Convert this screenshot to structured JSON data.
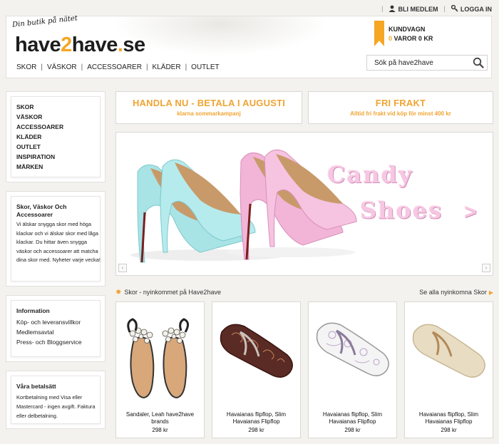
{
  "topbar": {
    "join": "BLI MEDLEM",
    "login": "LOGGA IN"
  },
  "header": {
    "tagline": "Din butik på nätet",
    "logo": {
      "part1": "have",
      "part2": "2",
      "part3": "have",
      "part4": ".",
      "part5": "se"
    },
    "nav": [
      "SKOR",
      "VÄSKOR",
      "ACCESSOARER",
      "KLÄDER",
      "OUTLET"
    ],
    "cart": {
      "title": "KUNDVAGN",
      "count": "0",
      "items_label": " VAROR ",
      "amount": "0 KR"
    },
    "search": {
      "placeholder": "Sök på have2have"
    }
  },
  "sidebar": {
    "categories": [
      "SKOR",
      "VÄSKOR",
      "ACCESSOARER",
      "KLÄDER",
      "OUTLET",
      "INSPIRATION",
      "MÄRKEN"
    ],
    "about": {
      "title": "Skor, Väskor Och Accessoarer",
      "text": "Vi älskar snygga skor med höga klackar och vi älskar skor med låga klackar. Du hittar även snygga väskor och accessoarer att matcha dina skor med. Nyheter varje vecka!"
    },
    "info": {
      "title": "Information",
      "links": [
        "Köp- och leveransvillkor",
        "Medlemsavtal",
        "Press- och Bloggservice"
      ]
    },
    "payment": {
      "title": "Våra betalsätt",
      "text": "Kortbetalning med Visa eller Mastercard - ingen avgift. Faktura eller delbetalning."
    }
  },
  "promos": [
    {
      "title": "HANDLA NU - BETALA I AUGUSTI",
      "subtitle": "klarna sommarkampanj"
    },
    {
      "title": "FRI FRAKT",
      "subtitle": "Alltid fri frakt vid köp för minst 400 kr"
    }
  ],
  "banner": {
    "line1": "Candy",
    "line2": "Shoes",
    "arrow": ">"
  },
  "section": {
    "title": "Skor - nyinkommet på Have2have",
    "see_all": "Se alla nyinkomna Skor"
  },
  "products": [
    {
      "name": "Sandaler, Leah have2have brands",
      "price": "298 kr"
    },
    {
      "name": "Havaianas flipflop, Slim Havaianas Flipflop",
      "price": "298 kr"
    },
    {
      "name": "Havaianas flipflop, Slim Havaianas Flipflop",
      "price": "298 kr"
    },
    {
      "name": "Havaianas flipflop, Slim Havaianas Flipflop",
      "price": "298 kr"
    }
  ],
  "colors": {
    "accent": "#f5a623",
    "banner_text": "#f6c7e2",
    "blue_shoe": "#a8e3e6",
    "pink_shoe": "#f2b5d8"
  },
  "icons": [
    "user-icon",
    "key-icon",
    "bookmark-flag-icon",
    "search-icon",
    "star-icon",
    "triangle-right-icon",
    "chevron-left-icon",
    "chevron-right-icon"
  ]
}
